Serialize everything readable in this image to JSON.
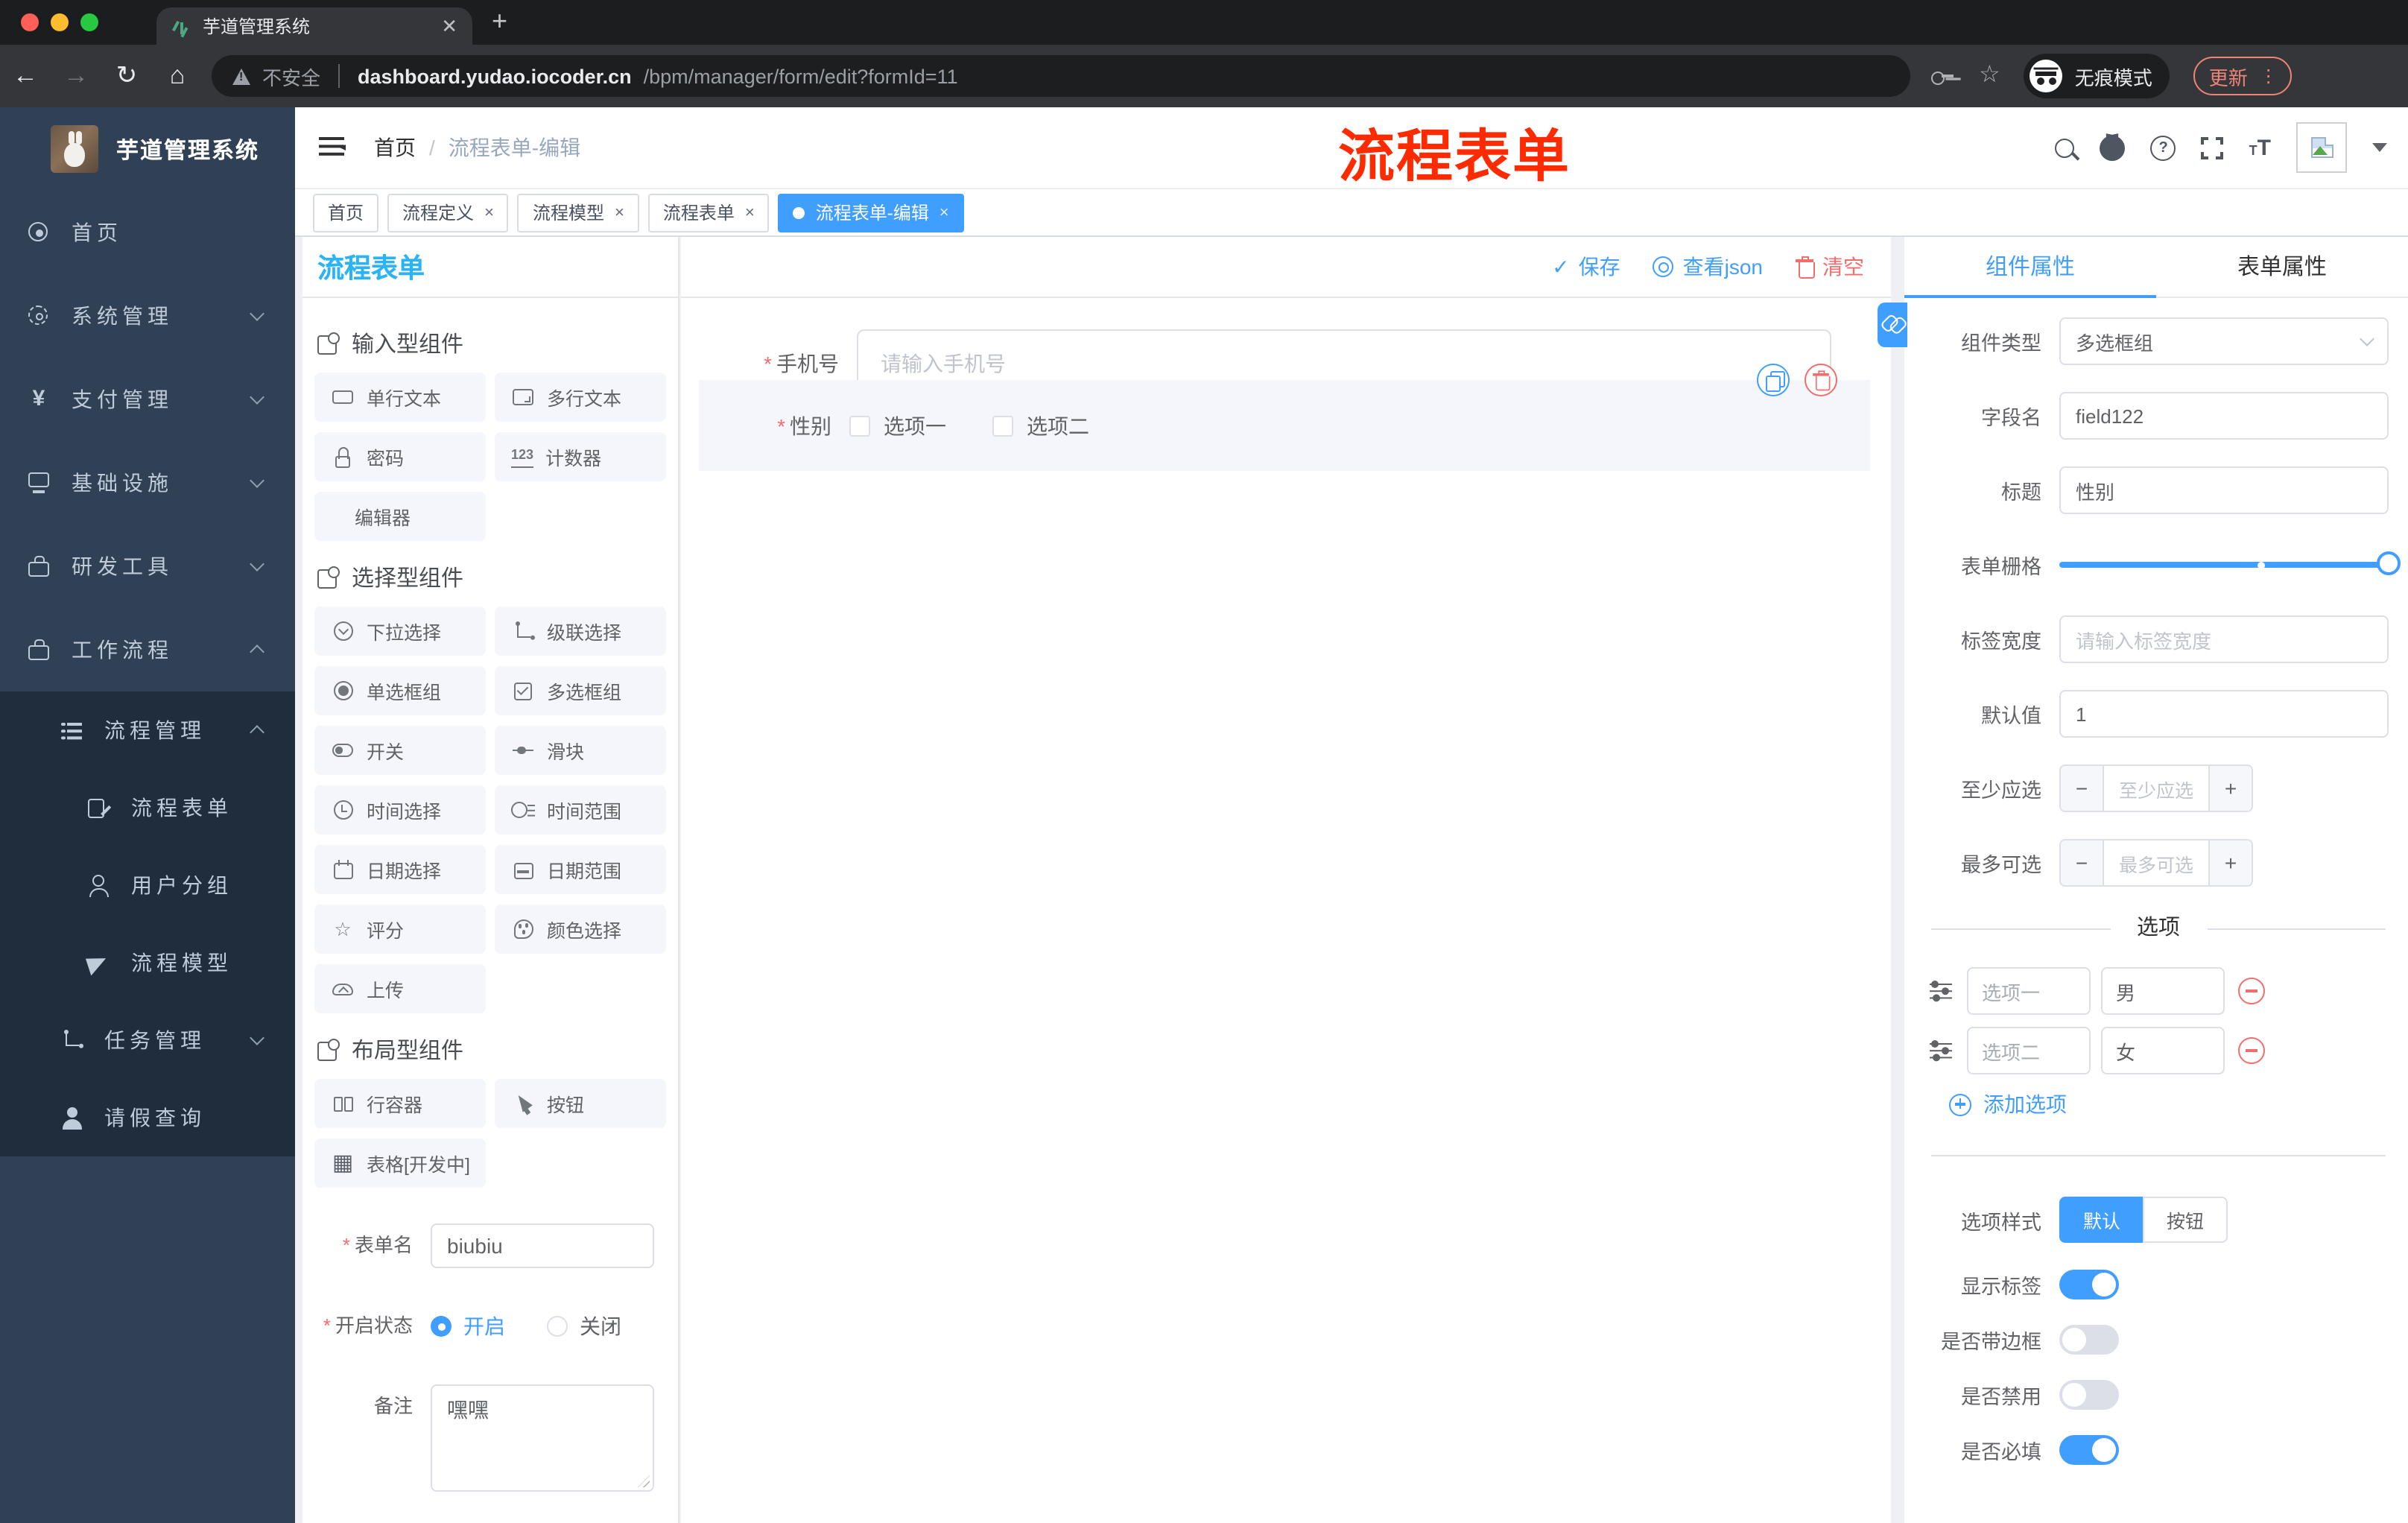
{
  "browser": {
    "tab_title": "芋道管理系统",
    "not_secure": "不安全",
    "url_host": "dashboard.yudao.iocoder.cn",
    "url_path": "/bpm/manager/form/edit?formId=11",
    "incognito_label": "无痕模式",
    "update_label": "更新"
  },
  "header": {
    "breadcrumb_home": "首页",
    "breadcrumb_sep": "/",
    "breadcrumb_current": "流程表单-编辑",
    "annotation": "流程表单"
  },
  "sidebar": {
    "logo_title": "芋道管理系统",
    "top_items": [
      {
        "label": "首页",
        "icon": "dashboard",
        "chevron": ""
      },
      {
        "label": "系统管理",
        "icon": "gear",
        "chevron": "down"
      },
      {
        "label": "支付管理",
        "icon": "yen",
        "chevron": "down"
      },
      {
        "label": "基础设施",
        "icon": "monitor",
        "chevron": "down"
      },
      {
        "label": "研发工具",
        "icon": "toolbox",
        "chevron": "down"
      },
      {
        "label": "工作流程",
        "icon": "toolbox",
        "chevron": "up"
      }
    ],
    "sub_items": [
      {
        "label": "流程管理",
        "icon": "list",
        "chevron": "up",
        "level": 1
      },
      {
        "label": "流程表单",
        "icon": "docedit",
        "chevron": "",
        "level": 2
      },
      {
        "label": "用户分组",
        "icon": "users",
        "chevron": "",
        "level": 2
      },
      {
        "label": "流程模型",
        "icon": "plane",
        "chevron": "",
        "level": 2
      },
      {
        "label": "任务管理",
        "icon": "tasktree",
        "chevron": "down",
        "level": 1
      },
      {
        "label": "请假查询",
        "icon": "person",
        "chevron": "",
        "level": 1
      }
    ]
  },
  "page_tabs": [
    {
      "label": "首页",
      "closable": false,
      "active": false
    },
    {
      "label": "流程定义",
      "closable": true,
      "active": false
    },
    {
      "label": "流程模型",
      "closable": true,
      "active": false
    },
    {
      "label": "流程表单",
      "closable": true,
      "active": false
    },
    {
      "label": "流程表单-编辑",
      "closable": true,
      "active": true
    }
  ],
  "designer": {
    "title": "流程表单",
    "save_label": "保存",
    "view_json_label": "查看json",
    "clear_label": "清空"
  },
  "components_panel": {
    "sections": [
      {
        "title": "输入型组件",
        "items": [
          {
            "label": "单行文本",
            "icon": "input"
          },
          {
            "label": "多行文本",
            "icon": "textarea"
          },
          {
            "label": "密码",
            "icon": "lock"
          },
          {
            "label": "计数器",
            "icon": "counter"
          },
          {
            "label": "编辑器",
            "icon": "none"
          }
        ]
      },
      {
        "title": "选择型组件",
        "items": [
          {
            "label": "下拉选择",
            "icon": "dropdown"
          },
          {
            "label": "级联选择",
            "icon": "cascade"
          },
          {
            "label": "单选框组",
            "icon": "radio"
          },
          {
            "label": "多选框组",
            "icon": "checkbox"
          },
          {
            "label": "开关",
            "icon": "switch"
          },
          {
            "label": "滑块",
            "icon": "slider"
          },
          {
            "label": "时间选择",
            "icon": "time"
          },
          {
            "label": "时间范围",
            "icon": "timerange"
          },
          {
            "label": "日期选择",
            "icon": "date"
          },
          {
            "label": "日期范围",
            "icon": "daterange"
          },
          {
            "label": "评分",
            "icon": "star"
          },
          {
            "label": "颜色选择",
            "icon": "color"
          },
          {
            "label": "上传",
            "icon": "upload"
          }
        ]
      },
      {
        "title": "布局型组件",
        "items": [
          {
            "label": "行容器",
            "icon": "row"
          },
          {
            "label": "按钮",
            "icon": "button"
          },
          {
            "label": "表格[开发中]",
            "icon": "table"
          }
        ]
      }
    ],
    "form": {
      "name_label": "表单名",
      "name_value": "biubiu",
      "status_label": "开启状态",
      "status_on": "开启",
      "status_off": "关闭",
      "remark_label": "备注",
      "remark_value": "嘿嘿"
    }
  },
  "canvas": {
    "phone_label": "手机号",
    "phone_placeholder": "请输入手机号",
    "gender_label": "性别",
    "gender_options": [
      "选项一",
      "选项二"
    ]
  },
  "props_panel": {
    "tab_component": "组件属性",
    "tab_form": "表单属性",
    "type_label": "组件类型",
    "type_value": "多选框组",
    "field_label": "字段名",
    "field_value": "field122",
    "title_label": "标题",
    "title_value": "性别",
    "grid_label": "表单栅格",
    "width_label": "标签宽度",
    "width_placeholder": "请输入标签宽度",
    "default_label": "默认值",
    "default_value": "1",
    "min_label": "至少应选",
    "min_placeholder": "至少应选",
    "max_label": "最多可选",
    "max_placeholder": "最多可选",
    "options_title": "选项",
    "options": [
      {
        "label": "选项一",
        "value": "男"
      },
      {
        "label": "选项二",
        "value": "女"
      }
    ],
    "add_option_label": "添加选项",
    "style_label": "选项样式",
    "style_options": [
      "默认",
      "按钮"
    ],
    "style_active_index": 0,
    "toggles": [
      {
        "label": "显示标签",
        "on": true
      },
      {
        "label": "是否带边框",
        "on": false
      },
      {
        "label": "是否禁用",
        "on": false
      },
      {
        "label": "是否必填",
        "on": true
      }
    ]
  },
  "colors": {
    "accent": "#409eff",
    "designer_title": "#2ab4f5",
    "danger": "#f56c6c",
    "annotation_red": "#ff2b00",
    "sidebar_bg": "#304156",
    "sidebar_submenu_bg": "#1f2d3d"
  }
}
